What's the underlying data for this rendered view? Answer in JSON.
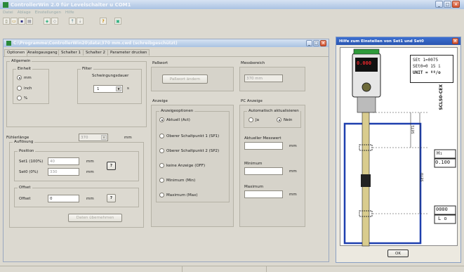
{
  "app": {
    "title": "ControllerWin 2.0  für  Levelschalter u COM1"
  },
  "menu": [
    "Datei",
    "Ablage",
    "Einstellungen",
    "Hilfe"
  ],
  "doc": {
    "title": "C:\\Programme\\ControllerWin20\\data\\370 mm.cwd (schreibgeschützt)",
    "tabs": [
      "Optionen",
      "Analogausgang",
      "Schalter 1",
      "Schalter 2",
      "Parameter drucken"
    ],
    "allgemein": {
      "title": "Allgemein",
      "einheit": {
        "title": "Einheit",
        "options": [
          "mm",
          "inch",
          "%"
        ],
        "selected": 0
      },
      "filter": {
        "title": "Filter",
        "label": "Schwingungsdauer",
        "value": "1",
        "unit": "s"
      }
    },
    "fuehlerlaenge": {
      "label": "Fühlerlänge",
      "value": "370",
      "unit": "mm"
    },
    "aufloesung": {
      "title": "Auflösung",
      "position": {
        "title": "Position",
        "set1_label": "Set1 (100%)",
        "set1_value": "40",
        "set0_label": "Set0 (0%)",
        "set0_value": "330",
        "unit": "mm",
        "help": "?"
      },
      "offset": {
        "title": "Offset",
        "label": "Offset",
        "value": "0",
        "unit": "mm",
        "help": "?"
      }
    },
    "daten_button": "Daten übernehmen",
    "pallwort": {
      "title": "Paßwort",
      "button": "Paßwort ändern"
    },
    "messbereich": {
      "title": "Messbereich",
      "value": "370 mm"
    },
    "anzeige": {
      "title": "Anzeige",
      "sub": "Anzeigeoptionen",
      "options": [
        "Aktuell (Act)",
        "Oberer Schaltpunkt 1 (SP1)",
        "Oberer Schaltpunkt 2 (SP2)",
        "keine Anzeige (OFF)",
        "Minimum (Min)",
        "Maximum (Max)"
      ],
      "selected": 0
    },
    "pc_anzeige": {
      "title": "PC Anzeige",
      "sub": "Automatisch aktualisieren",
      "options": [
        "Ja",
        "Nein"
      ],
      "selected": 1,
      "fields": [
        {
          "label": "Aktueller Messwert",
          "unit": "mm"
        },
        {
          "label": "Minimum",
          "unit": "mm"
        },
        {
          "label": "Maximum",
          "unit": "mm"
        }
      ]
    }
  },
  "help": {
    "title": "Hilfe zum Einstellen von Set1 und Set0",
    "display_lines": [
      "SEt 1=0075",
      "SEt0=0 15 i",
      "UNIT = ºº/o"
    ],
    "sensor_label": "SCLS0-CEX",
    "device_display": "0.000",
    "set1_label": "SET1",
    "set0_label": "SET0",
    "lcd_top_label": "H₁",
    "lcd_top_value": "0.100",
    "lcd_bottom_value": "0000",
    "lcd_bottom_label": "L o",
    "ok": "OK"
  },
  "colors": {
    "title_blue": "#aac2e2",
    "close_red": "#d2512f",
    "tank_blue": "#1e3fae",
    "bg": "#dcd9d0"
  }
}
